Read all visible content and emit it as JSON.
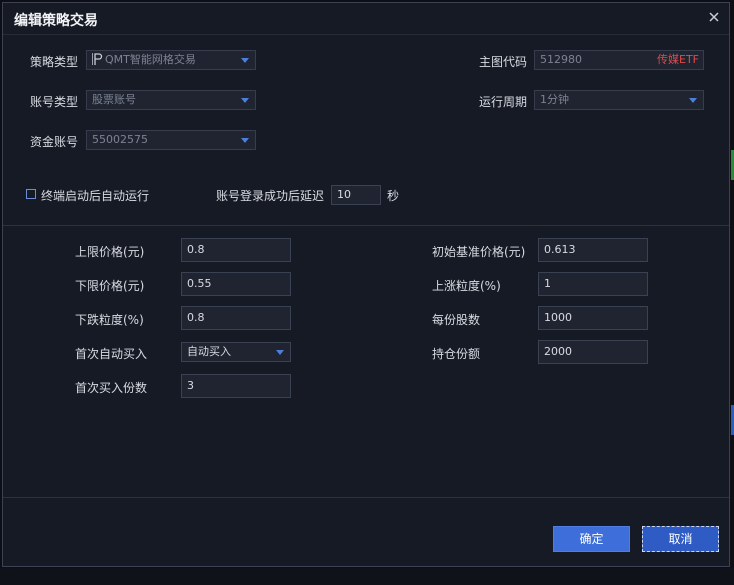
{
  "dialog": {
    "title": "编辑策略交易"
  },
  "strategy_type": {
    "label": "策略类型",
    "value": "QMT智能网格交易"
  },
  "main_code": {
    "label": "主图代码",
    "value": "512980",
    "tag": "传媒ETF"
  },
  "account_type": {
    "label": "账号类型",
    "value": "股票账号"
  },
  "run_period": {
    "label": "运行周期",
    "value": "1分钟"
  },
  "fund_account": {
    "label": "资金账号",
    "value": "55002575"
  },
  "auto_run": {
    "label": "终端启动后自动运行",
    "checked": false
  },
  "login_delay": {
    "label": "账号登录成功后延迟",
    "value": "10",
    "unit": "秒"
  },
  "params": {
    "upper_price": {
      "label": "上限价格(元)",
      "value": "0.8"
    },
    "lower_price": {
      "label": "下限价格(元)",
      "value": "0.55"
    },
    "fall_grain": {
      "label": "下跌粒度(%)",
      "value": "0.8"
    },
    "first_auto_buy": {
      "label": "首次自动买入",
      "value": "自动买入"
    },
    "first_buy_shares": {
      "label": "首次买入份数",
      "value": "3"
    },
    "base_price": {
      "label": "初始基准价格(元)",
      "value": "0.613"
    },
    "rise_grain": {
      "label": "上涨粒度(%)",
      "value": "1"
    },
    "per_share_count": {
      "label": "每份股数",
      "value": "1000"
    },
    "position_amount": {
      "label": "持仓份额",
      "value": "2000"
    }
  },
  "buttons": {
    "ok": "确定",
    "cancel": "取消"
  },
  "colors": {
    "accent": "#3d6ed9",
    "etf_tag": "#e04a4a",
    "background": "#161a24"
  }
}
